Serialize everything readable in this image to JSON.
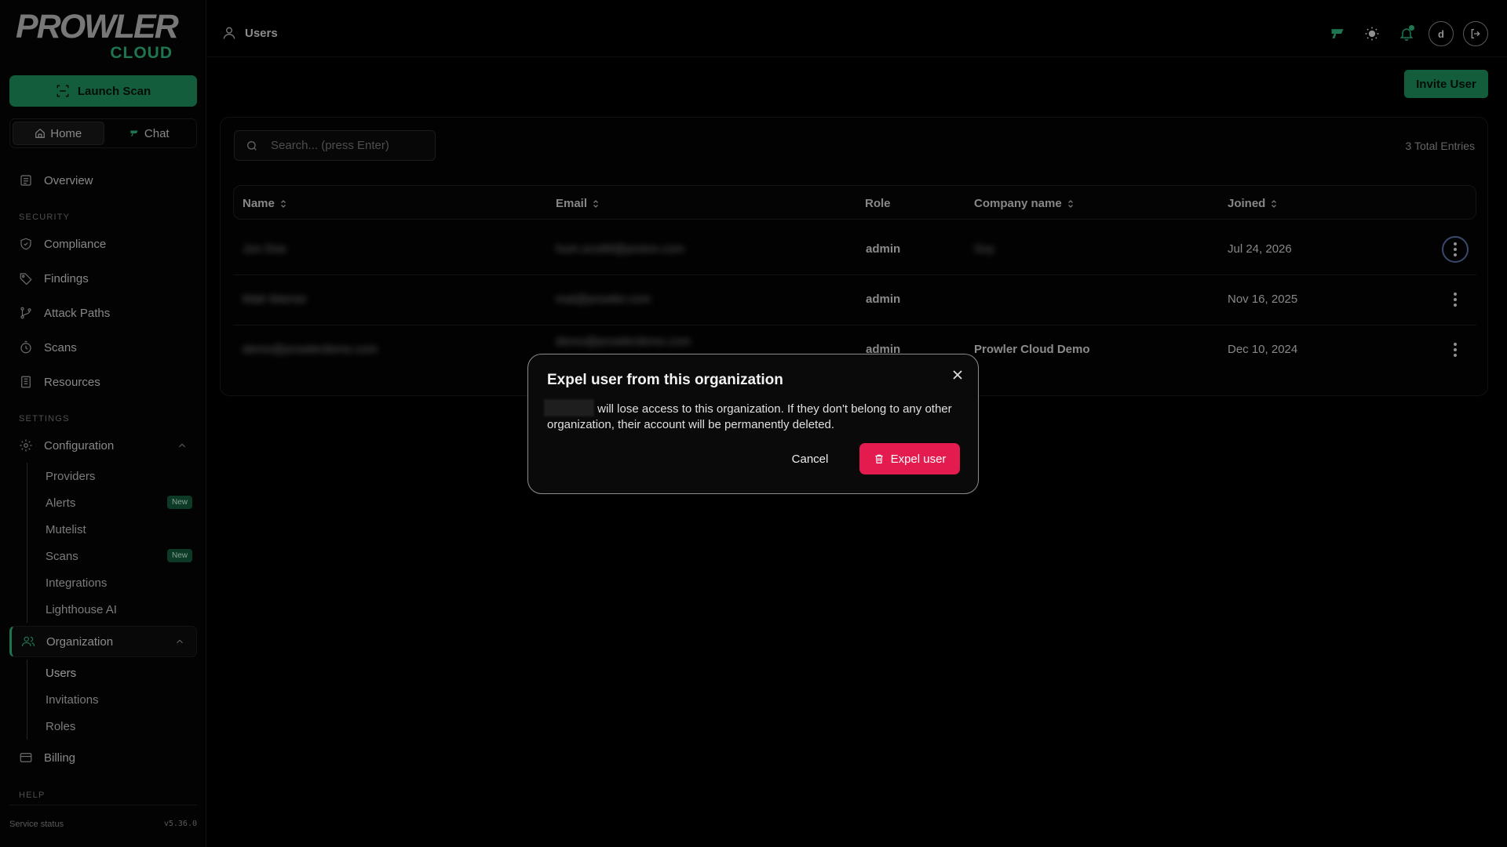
{
  "brand": {
    "name": "PROWLER",
    "sub": "CLOUD",
    "accent": "#2db57a"
  },
  "sidebar": {
    "launch_label": "Launch Scan",
    "seg": {
      "home": "Home",
      "chat": "Chat"
    },
    "overview": "Overview",
    "security_label": "SECURITY",
    "security_items": [
      "Compliance",
      "Findings",
      "Attack Paths",
      "Scans",
      "Resources"
    ],
    "settings_label": "SETTINGS",
    "configuration": "Configuration",
    "config_items": [
      "Providers",
      "Alerts",
      "Mutelist",
      "Scans",
      "Integrations",
      "Lighthouse AI"
    ],
    "new_badge": "New",
    "organization": "Organization",
    "org_items": [
      "Users",
      "Invitations",
      "Roles"
    ],
    "billing": "Billing",
    "help_label": "HELP",
    "service_status": "Service status",
    "version": "v5.36.0"
  },
  "topbar": {
    "title": "Users",
    "avatar_initial": "d"
  },
  "main": {
    "invite_label": "Invite User",
    "search_placeholder": "Search... (press Enter)",
    "total": "3 Total Entries",
    "columns": {
      "name": "Name",
      "email": "Email",
      "role": "Role",
      "company": "Company name",
      "joined": "Joined"
    },
    "rows": [
      {
        "name": "Jon Doe",
        "email": "hum.scott9@proton.com",
        "role": "admin",
        "company": "Soy",
        "joined": "Jul 24, 2026"
      },
      {
        "name": "Matt Warner",
        "email": "mat@prowler.com",
        "role": "admin",
        "company": "",
        "joined": "Nov 16, 2025"
      },
      {
        "name": "demo@prowlerdemo.com",
        "email": "demo@prowlerdemo.com",
        "role": "admin",
        "company": "Prowler Cloud Demo",
        "joined": "Dec 10, 2024"
      }
    ]
  },
  "modal": {
    "title": "Expel user from this organization",
    "body": "will lose access to this organization. If they don't belong to any other organization, their account will be permanently deleted.",
    "cancel": "Cancel",
    "confirm": "Expel user",
    "confirm_color": "#e31b4f"
  }
}
